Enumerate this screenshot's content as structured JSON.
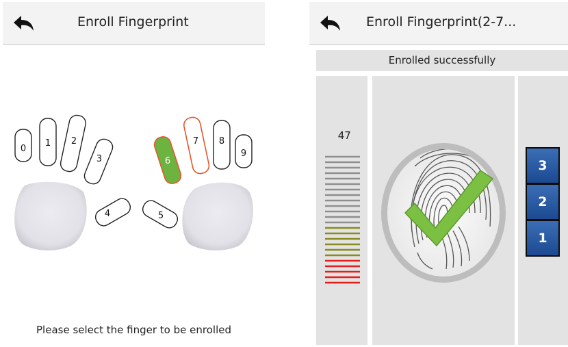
{
  "left_screen": {
    "title": "Enroll Fingerprint",
    "hint": "Please select the finger to be enrolled",
    "fingers": {
      "f0": "0",
      "f1": "1",
      "f2": "2",
      "f3": "3",
      "f4": "4",
      "f5": "5",
      "f6": "6",
      "f7": "7",
      "f8": "8",
      "f9": "9"
    },
    "selected_finger": "6",
    "highlighted_finger": "7"
  },
  "right_screen": {
    "title": "Enroll Fingerprint(2-7...",
    "status": "Enrolled successfully",
    "quality_value": "47",
    "steps": [
      "3",
      "2",
      "1"
    ]
  },
  "colors": {
    "selected_fill": "#6db33f",
    "highlight_outline": "#e2572d",
    "step_blue": "#2457a3",
    "check_green": "#7bc043"
  }
}
